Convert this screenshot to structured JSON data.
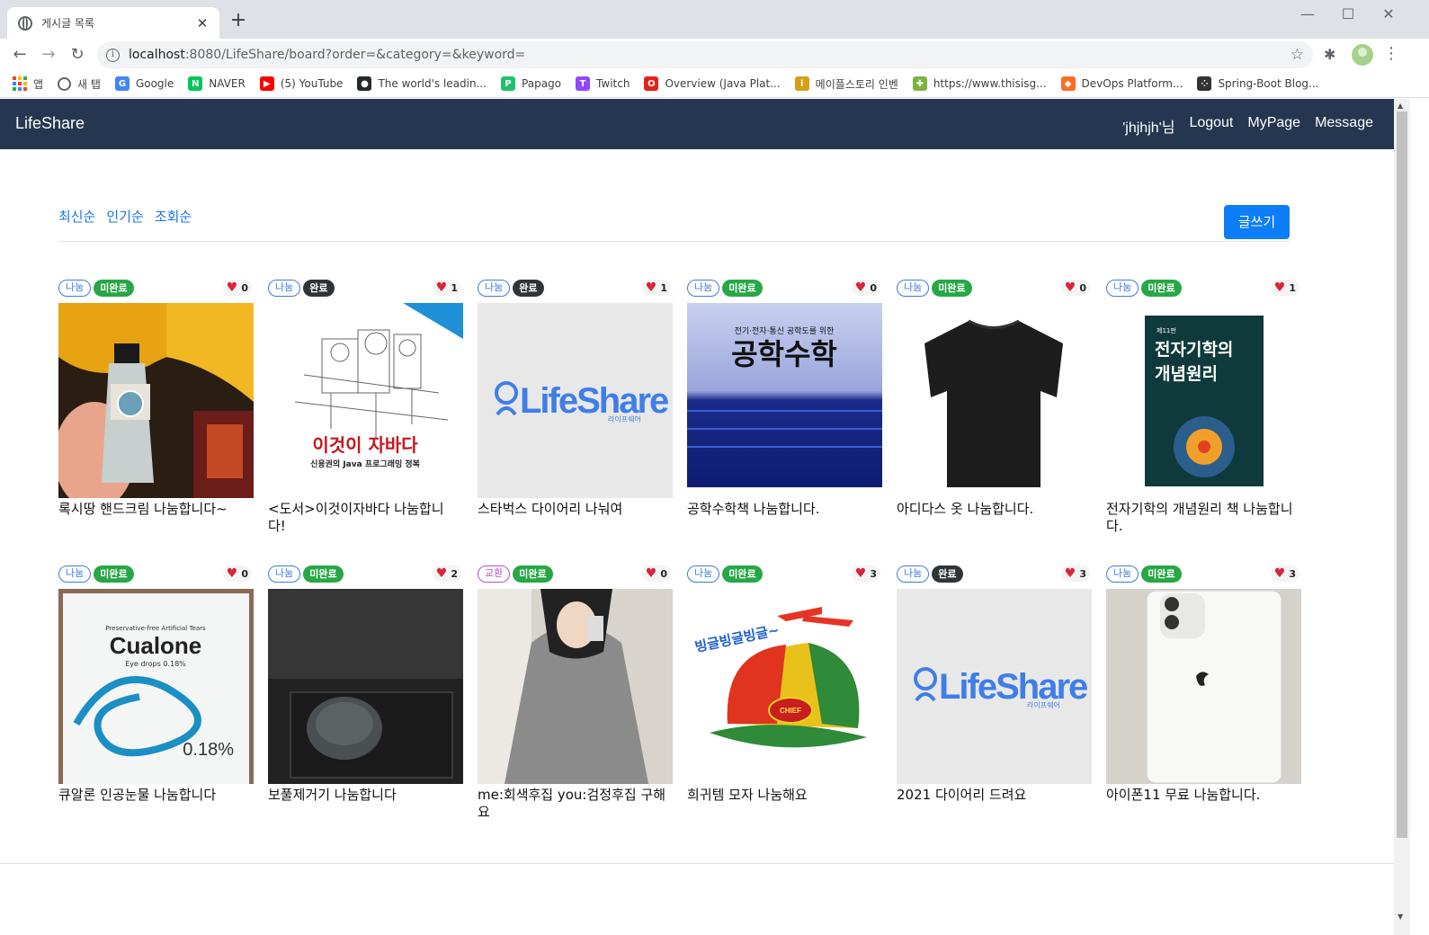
{
  "browser": {
    "tab_title": "게시글 목록",
    "url_host": "localhost",
    "url_rest": ":8080/LifeShare/board?order=&category=&keyword=",
    "bookmarks": [
      {
        "label": "앱",
        "icon": "apps-grid-icon"
      },
      {
        "label": "새 탭",
        "icon": "globe-icon",
        "color": "#5f6368"
      },
      {
        "label": "Google",
        "icon": "google-icon",
        "color": "#4285f4",
        "glyph": "G"
      },
      {
        "label": "NAVER",
        "icon": "naver-icon",
        "color": "#03c75a",
        "glyph": "N"
      },
      {
        "label": "(5) YouTube",
        "icon": "youtube-icon",
        "color": "#ff0000",
        "glyph": "▶"
      },
      {
        "label": "The world's leadin...",
        "icon": "github-icon",
        "color": "#24292e",
        "glyph": "●"
      },
      {
        "label": "Papago",
        "icon": "papago-icon",
        "color": "#1ec26a",
        "glyph": "P"
      },
      {
        "label": "Twitch",
        "icon": "twitch-icon",
        "color": "#9146ff",
        "glyph": "T"
      },
      {
        "label": "Overview (Java Plat...",
        "icon": "oracle-icon",
        "color": "#e2231a",
        "glyph": "O"
      },
      {
        "label": "메이플스토리 인벤",
        "icon": "inven-icon",
        "color": "#d4a017",
        "glyph": "i"
      },
      {
        "label": "https://www.thisisg...",
        "icon": "puzzle-icon",
        "color": "#7cb342",
        "glyph": "✚"
      },
      {
        "label": "DevOps Platform...",
        "icon": "gitlab-icon",
        "color": "#fc6d26",
        "glyph": "◆"
      },
      {
        "label": "Spring-Boot Blog...",
        "icon": "blog-icon",
        "color": "#333333",
        "glyph": "⁘"
      }
    ]
  },
  "navbar": {
    "brand": "LifeShare",
    "user": "'jhjhjh'님",
    "logout": "Logout",
    "mypage": "MyPage",
    "message": "Message"
  },
  "sort": {
    "latest": "최신순",
    "popular": "인기순",
    "views": "조회순",
    "write": "글쓰기"
  },
  "posts": [
    {
      "category": "나눔",
      "status": "미완료",
      "likes": "0",
      "title": "록시땅 핸드크림 나눔합니다~",
      "image": "hand-cream"
    },
    {
      "category": "나눔",
      "status": "완료",
      "likes": "1",
      "title": "<도서>이것이자바다 나눔합니다!",
      "image": "java-book"
    },
    {
      "category": "나눔",
      "status": "완료",
      "likes": "1",
      "title": "스타벅스 다이어리 나눠여",
      "image": "lifeshare-logo"
    },
    {
      "category": "나눔",
      "status": "미완료",
      "likes": "0",
      "title": "공학수학책 나눔합니다.",
      "image": "math-book"
    },
    {
      "category": "나눔",
      "status": "미완료",
      "likes": "0",
      "title": "아디다스 옷 나눔합니다.",
      "image": "tshirt"
    },
    {
      "category": "나눔",
      "status": "미완료",
      "likes": "1",
      "title": "전자기학의 개념원리 책 나눔합니다.",
      "image": "em-book"
    },
    {
      "category": "나눔",
      "status": "미완료",
      "likes": "0",
      "title": "큐알론 인공눈물 나눔합니다",
      "image": "cualone"
    },
    {
      "category": "나눔",
      "status": "미완료",
      "likes": "2",
      "title": "보풀제거기 나눔합니다",
      "image": "lint-remover"
    },
    {
      "category": "교환",
      "status": "미완료",
      "likes": "0",
      "title": "me:회색후집 you:검정후집 구해요",
      "image": "hoodie"
    },
    {
      "category": "나눔",
      "status": "미완료",
      "likes": "3",
      "title": "희귀템 모자 나눔해요",
      "image": "propeller-hat"
    },
    {
      "category": "나눔",
      "status": "완료",
      "likes": "3",
      "title": "2021 다이어리 드려요",
      "image": "lifeshare-logo"
    },
    {
      "category": "나눔",
      "status": "미완료",
      "likes": "3",
      "title": "아이폰11 무료 나눔합니다.",
      "image": "iphone-box"
    }
  ],
  "image_text": {
    "logo_main": "LifeShare",
    "logo_sub": "라이프쉐어",
    "java_title": "이것이 자바다",
    "java_sub": "신용권의 Java 프로그래밍 정복",
    "math_top": "전기·전자·통신 공학도를 위한",
    "math_title": "공학수학",
    "em_edition": "제11판",
    "em_title1": "전자기학의",
    "em_title2": "개념원리",
    "cualone_top": "Preservative-free Artificial Tears",
    "cualone_name": "Cualone",
    "cualone_sub": "Eye drops 0.18%",
    "cualone_pct": "0.18%",
    "hat_text": "빙글빙글빙글~",
    "hat_badge": "CHIEF"
  },
  "colors": {
    "navbar": "#253750",
    "primary": "#0d7ef8",
    "status_open": "#27a745",
    "status_done": "#2f3439",
    "heart": "#d9253c",
    "link": "#1a73e8"
  }
}
